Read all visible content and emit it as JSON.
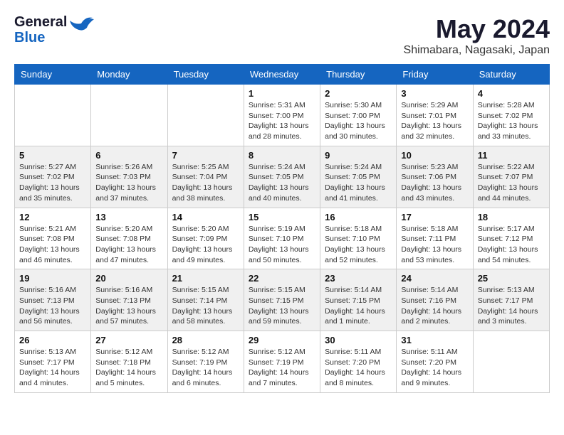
{
  "header": {
    "logo_line1": "General",
    "logo_line2": "Blue",
    "month_year": "May 2024",
    "location": "Shimabara, Nagasaki, Japan"
  },
  "days_of_week": [
    "Sunday",
    "Monday",
    "Tuesday",
    "Wednesday",
    "Thursday",
    "Friday",
    "Saturday"
  ],
  "weeks": [
    [
      {
        "day": "",
        "sunrise": "",
        "sunset": "",
        "daylight": ""
      },
      {
        "day": "",
        "sunrise": "",
        "sunset": "",
        "daylight": ""
      },
      {
        "day": "",
        "sunrise": "",
        "sunset": "",
        "daylight": ""
      },
      {
        "day": "1",
        "sunrise": "Sunrise: 5:31 AM",
        "sunset": "Sunset: 7:00 PM",
        "daylight": "Daylight: 13 hours and 28 minutes."
      },
      {
        "day": "2",
        "sunrise": "Sunrise: 5:30 AM",
        "sunset": "Sunset: 7:00 PM",
        "daylight": "Daylight: 13 hours and 30 minutes."
      },
      {
        "day": "3",
        "sunrise": "Sunrise: 5:29 AM",
        "sunset": "Sunset: 7:01 PM",
        "daylight": "Daylight: 13 hours and 32 minutes."
      },
      {
        "day": "4",
        "sunrise": "Sunrise: 5:28 AM",
        "sunset": "Sunset: 7:02 PM",
        "daylight": "Daylight: 13 hours and 33 minutes."
      }
    ],
    [
      {
        "day": "5",
        "sunrise": "Sunrise: 5:27 AM",
        "sunset": "Sunset: 7:02 PM",
        "daylight": "Daylight: 13 hours and 35 minutes."
      },
      {
        "day": "6",
        "sunrise": "Sunrise: 5:26 AM",
        "sunset": "Sunset: 7:03 PM",
        "daylight": "Daylight: 13 hours and 37 minutes."
      },
      {
        "day": "7",
        "sunrise": "Sunrise: 5:25 AM",
        "sunset": "Sunset: 7:04 PM",
        "daylight": "Daylight: 13 hours and 38 minutes."
      },
      {
        "day": "8",
        "sunrise": "Sunrise: 5:24 AM",
        "sunset": "Sunset: 7:05 PM",
        "daylight": "Daylight: 13 hours and 40 minutes."
      },
      {
        "day": "9",
        "sunrise": "Sunrise: 5:24 AM",
        "sunset": "Sunset: 7:05 PM",
        "daylight": "Daylight: 13 hours and 41 minutes."
      },
      {
        "day": "10",
        "sunrise": "Sunrise: 5:23 AM",
        "sunset": "Sunset: 7:06 PM",
        "daylight": "Daylight: 13 hours and 43 minutes."
      },
      {
        "day": "11",
        "sunrise": "Sunrise: 5:22 AM",
        "sunset": "Sunset: 7:07 PM",
        "daylight": "Daylight: 13 hours and 44 minutes."
      }
    ],
    [
      {
        "day": "12",
        "sunrise": "Sunrise: 5:21 AM",
        "sunset": "Sunset: 7:08 PM",
        "daylight": "Daylight: 13 hours and 46 minutes."
      },
      {
        "day": "13",
        "sunrise": "Sunrise: 5:20 AM",
        "sunset": "Sunset: 7:08 PM",
        "daylight": "Daylight: 13 hours and 47 minutes."
      },
      {
        "day": "14",
        "sunrise": "Sunrise: 5:20 AM",
        "sunset": "Sunset: 7:09 PM",
        "daylight": "Daylight: 13 hours and 49 minutes."
      },
      {
        "day": "15",
        "sunrise": "Sunrise: 5:19 AM",
        "sunset": "Sunset: 7:10 PM",
        "daylight": "Daylight: 13 hours and 50 minutes."
      },
      {
        "day": "16",
        "sunrise": "Sunrise: 5:18 AM",
        "sunset": "Sunset: 7:10 PM",
        "daylight": "Daylight: 13 hours and 52 minutes."
      },
      {
        "day": "17",
        "sunrise": "Sunrise: 5:18 AM",
        "sunset": "Sunset: 7:11 PM",
        "daylight": "Daylight: 13 hours and 53 minutes."
      },
      {
        "day": "18",
        "sunrise": "Sunrise: 5:17 AM",
        "sunset": "Sunset: 7:12 PM",
        "daylight": "Daylight: 13 hours and 54 minutes."
      }
    ],
    [
      {
        "day": "19",
        "sunrise": "Sunrise: 5:16 AM",
        "sunset": "Sunset: 7:13 PM",
        "daylight": "Daylight: 13 hours and 56 minutes."
      },
      {
        "day": "20",
        "sunrise": "Sunrise: 5:16 AM",
        "sunset": "Sunset: 7:13 PM",
        "daylight": "Daylight: 13 hours and 57 minutes."
      },
      {
        "day": "21",
        "sunrise": "Sunrise: 5:15 AM",
        "sunset": "Sunset: 7:14 PM",
        "daylight": "Daylight: 13 hours and 58 minutes."
      },
      {
        "day": "22",
        "sunrise": "Sunrise: 5:15 AM",
        "sunset": "Sunset: 7:15 PM",
        "daylight": "Daylight: 13 hours and 59 minutes."
      },
      {
        "day": "23",
        "sunrise": "Sunrise: 5:14 AM",
        "sunset": "Sunset: 7:15 PM",
        "daylight": "Daylight: 14 hours and 1 minute."
      },
      {
        "day": "24",
        "sunrise": "Sunrise: 5:14 AM",
        "sunset": "Sunset: 7:16 PM",
        "daylight": "Daylight: 14 hours and 2 minutes."
      },
      {
        "day": "25",
        "sunrise": "Sunrise: 5:13 AM",
        "sunset": "Sunset: 7:17 PM",
        "daylight": "Daylight: 14 hours and 3 minutes."
      }
    ],
    [
      {
        "day": "26",
        "sunrise": "Sunrise: 5:13 AM",
        "sunset": "Sunset: 7:17 PM",
        "daylight": "Daylight: 14 hours and 4 minutes."
      },
      {
        "day": "27",
        "sunrise": "Sunrise: 5:12 AM",
        "sunset": "Sunset: 7:18 PM",
        "daylight": "Daylight: 14 hours and 5 minutes."
      },
      {
        "day": "28",
        "sunrise": "Sunrise: 5:12 AM",
        "sunset": "Sunset: 7:19 PM",
        "daylight": "Daylight: 14 hours and 6 minutes."
      },
      {
        "day": "29",
        "sunrise": "Sunrise: 5:12 AM",
        "sunset": "Sunset: 7:19 PM",
        "daylight": "Daylight: 14 hours and 7 minutes."
      },
      {
        "day": "30",
        "sunrise": "Sunrise: 5:11 AM",
        "sunset": "Sunset: 7:20 PM",
        "daylight": "Daylight: 14 hours and 8 minutes."
      },
      {
        "day": "31",
        "sunrise": "Sunrise: 5:11 AM",
        "sunset": "Sunset: 7:20 PM",
        "daylight": "Daylight: 14 hours and 9 minutes."
      },
      {
        "day": "",
        "sunrise": "",
        "sunset": "",
        "daylight": ""
      }
    ]
  ]
}
